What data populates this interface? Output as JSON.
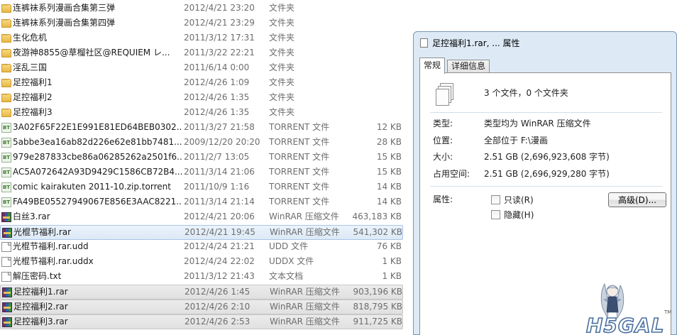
{
  "files": [
    {
      "icon": "folder-icon",
      "name": "连裤袜系列漫画合集第三弹",
      "date": "2012/4/21 23:20",
      "type": "文件夹",
      "size": ""
    },
    {
      "icon": "folder-icon",
      "name": "连裤袜系列漫画合集第四弹",
      "date": "2012/4/21 23:29",
      "type": "文件夹",
      "size": ""
    },
    {
      "icon": "folder-icon",
      "name": "生化危机",
      "date": "2011/3/12 17:31",
      "type": "文件夹",
      "size": ""
    },
    {
      "icon": "folder-icon",
      "name": "夜游神8855@草榴社区@REQUIEM レ...",
      "date": "2011/3/22 22:21",
      "type": "文件夹",
      "size": ""
    },
    {
      "icon": "folder-icon",
      "name": "淫乱三国",
      "date": "2011/6/14 0:00",
      "type": "文件夹",
      "size": ""
    },
    {
      "icon": "folder-icon",
      "name": "足控福利1",
      "date": "2012/4/26 1:09",
      "type": "文件夹",
      "size": ""
    },
    {
      "icon": "folder-icon",
      "name": "足控福利2",
      "date": "2012/4/26 1:35",
      "type": "文件夹",
      "size": ""
    },
    {
      "icon": "folder-icon",
      "name": "足控福利3",
      "date": "2012/4/26 1:35",
      "type": "文件夹",
      "size": ""
    },
    {
      "icon": "torrent-icon",
      "name": "3A02F65F22E1E991E81ED64BEB0302...",
      "date": "2011/3/27 21:58",
      "type": "TORRENT 文件",
      "size": "12 KB"
    },
    {
      "icon": "torrent-icon",
      "name": "5abbe3ea16ab82d226e62e81bb7481...",
      "date": "2009/12/20 20:20",
      "type": "TORRENT 文件",
      "size": "28 KB"
    },
    {
      "icon": "torrent-icon",
      "name": "979e287833cbe86a06285262a2501f6...",
      "date": "2011/2/7 13:05",
      "type": "TORRENT 文件",
      "size": "15 KB"
    },
    {
      "icon": "torrent-icon",
      "name": "AC5A072642A93D9429C1586CB72B4...",
      "date": "2011/3/14 21:06",
      "type": "TORRENT 文件",
      "size": "15 KB"
    },
    {
      "icon": "torrent-icon",
      "name": "comic kairakuten 2011-10.zip.torrent",
      "date": "2011/10/9 1:16",
      "type": "TORRENT 文件",
      "size": "14 KB"
    },
    {
      "icon": "torrent-icon",
      "name": "FA49BE05527949067E856E3AAC8221...",
      "date": "2011/3/14 21:14",
      "type": "TORRENT 文件",
      "size": "14 KB"
    },
    {
      "icon": "rar-icon",
      "name": "白丝3.rar",
      "date": "2012/4/21 20:06",
      "type": "WinRAR 压缩文件",
      "size": "463,183 KB"
    },
    {
      "icon": "rar-icon",
      "name": "光棍节福利.rar",
      "date": "2012/4/21 19:45",
      "type": "WinRAR 压缩文件",
      "size": "541,302 KB",
      "state": "sel"
    },
    {
      "icon": "document-icon",
      "name": "光棍节福利.rar.udd",
      "date": "2012/4/24 21:21",
      "type": "UDD 文件",
      "size": "76 KB"
    },
    {
      "icon": "document-icon",
      "name": "光棍节福利.rar.uddx",
      "date": "2012/4/24 22:02",
      "type": "UDDX 文件",
      "size": "1 KB"
    },
    {
      "icon": "document-icon",
      "name": "解压密码.txt",
      "date": "2011/3/12 21:43",
      "type": "文本文档",
      "size": "1 KB"
    },
    {
      "icon": "rar-icon",
      "name": "足控福利1.rar",
      "date": "2012/4/26 1:45",
      "type": "WinRAR 压缩文件",
      "size": "903,196 KB",
      "state": "gray"
    },
    {
      "icon": "rar-icon",
      "name": "足控福利2.rar",
      "date": "2012/4/26 2:10",
      "type": "WinRAR 压缩文件",
      "size": "818,795 KB",
      "state": "gray"
    },
    {
      "icon": "rar-icon",
      "name": "足控福利3.rar",
      "date": "2012/4/26 2:53",
      "type": "WinRAR 压缩文件",
      "size": "911,725 KB",
      "state": "gray"
    }
  ],
  "dialog": {
    "title": "足控福利1.rar, ... 属性",
    "tabs": [
      "常规",
      "详细信息"
    ],
    "summary": "3 个文件，0 个文件夹",
    "type_label": "类型:",
    "type_value": "类型均为 WinRAR 压缩文件",
    "location_label": "位置:",
    "location_value": "全部位于 F:\\漫画",
    "size_label": "大小:",
    "size_value": "2.51 GB (2,696,923,608 字节)",
    "disk_size_label": "占用空间:",
    "disk_size_value": "2.51 GB (2,696,929,280 字节)",
    "attributes_label": "属性:",
    "readonly_label": "只读(R)",
    "hidden_label": "隐藏(H)",
    "advanced_button": "高级(D)..."
  },
  "watermark": {
    "text": "H5GAL",
    "tm": "TM"
  },
  "colors": {
    "selection": "#dde9f6",
    "dialog_frame": "#ddeaf6",
    "folder": "#e8b844"
  }
}
